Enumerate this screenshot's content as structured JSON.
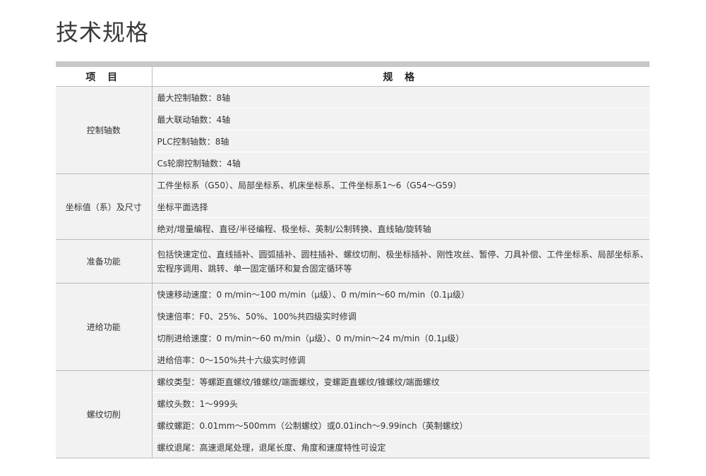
{
  "page": {
    "title": "技术规格"
  },
  "table": {
    "headers": [
      "项 目",
      "规 格"
    ],
    "groups": [
      {
        "category": "控制轴数",
        "specs": [
          "最大控制轴数：8轴",
          "最大联动轴数：4轴",
          "PLC控制轴数：8轴",
          "Cs轮廓控制轴数：4轴"
        ]
      },
      {
        "category": "坐标值（系）及尺寸",
        "specs": [
          "工件坐标系（G50）、局部坐标系、机床坐标系、工件坐标系1～6（G54～G59）",
          "坐标平面选择",
          "绝对/增量编程、直径/半径编程、极坐标、英制/公制转换、直线轴/旋转轴"
        ]
      },
      {
        "category": "准备功能",
        "specs": [
          "包括快速定位、直线插补、圆弧插补、圆柱插补、螺纹切削、极坐标插补、刚性攻丝、暂停、刀具补偿、工件坐标系、局部坐标系、宏程序调用、跳转、单一固定循环和复合固定循环等"
        ]
      },
      {
        "category": "进给功能",
        "specs": [
          "快速移动速度：0 m/min～100 m/min（μ级）、0 m/min～60 m/min（0.1μ级）",
          "快速倍率：F0、25%、50%、100%共四级实时修调",
          "切削进给速度：0 m/min～60 m/min（μ级）、0 m/min～24 m/min（0.1μ级）",
          "进给倍率：0～150%共十六级实时修调"
        ]
      },
      {
        "category": "螺纹切削",
        "specs": [
          "螺纹类型：等螺距直螺纹/锥螺纹/端面螺纹，变螺距直螺纹/锥螺纹/端面螺纹",
          "螺纹头数：1～999头",
          "螺纹螺距：0.01mm～500mm（公制螺纹）或0.01inch～9.99inch（英制螺纹）",
          "螺纹退尾：高速退尾处理，退尾长度、角度和速度特性可设定"
        ]
      }
    ]
  }
}
